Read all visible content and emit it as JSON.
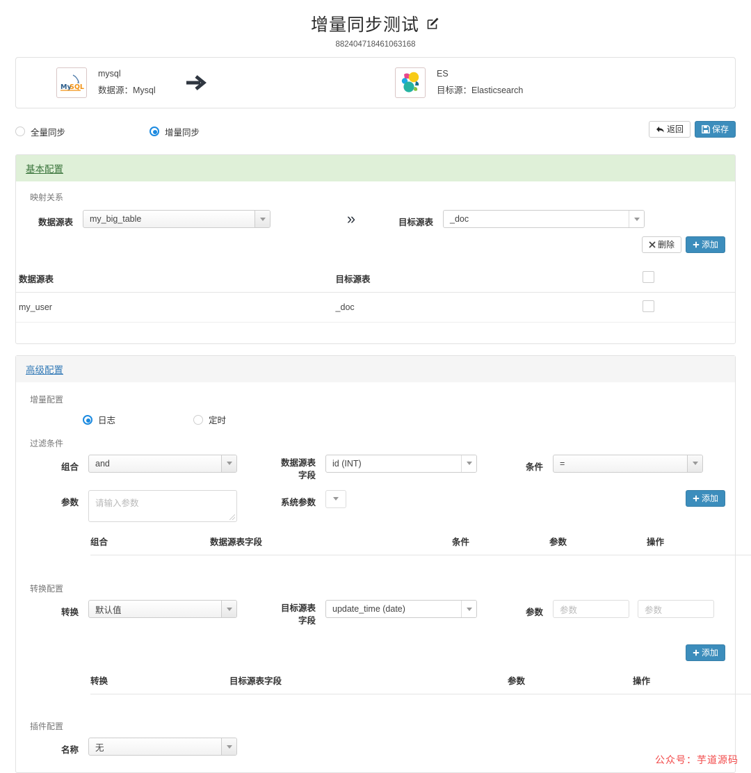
{
  "header": {
    "title": "增量同步测试",
    "edit_icon": "edit-pencil-icon",
    "job_id": "882404718461063168"
  },
  "datasource_panel": {
    "source": {
      "logo": "mysql-logo",
      "name": "mysql",
      "type_label": "数据源：Mysql"
    },
    "arrow_icon": "arrow-right-icon",
    "target": {
      "logo": "elasticsearch-logo",
      "name": "ES",
      "type_label": "目标源：Elasticsearch"
    }
  },
  "sync_mode": {
    "options": [
      {
        "label": "全量同步",
        "selected": false
      },
      {
        "label": "增量同步",
        "selected": true
      }
    ],
    "back_button": "返回",
    "save_button": "保存"
  },
  "basic_config": {
    "header": "基本配置",
    "mapping_label": "映射关系",
    "source_table_label": "数据源表",
    "source_table_value": "my_big_table",
    "chevron": "»",
    "target_table_label": "目标源表",
    "target_table_value": "_doc",
    "delete_button": "删除",
    "add_button": "添加",
    "table": {
      "columns": [
        "数据源表",
        "目标源表",
        ""
      ],
      "rows": [
        {
          "source": "my_user",
          "target": "_doc",
          "checked": false
        }
      ]
    }
  },
  "advanced_config": {
    "header": "高级配置",
    "incremental": {
      "label": "增量配置",
      "options": [
        {
          "label": "日志",
          "selected": true
        },
        {
          "label": "定时",
          "selected": false
        }
      ]
    },
    "filter": {
      "label": "过滤条件",
      "combine_label": "组合",
      "combine_value": "and",
      "field_label": "数据源表\n字段",
      "field_label_line1": "数据源表",
      "field_label_line2": "字段",
      "field_value": "id (INT)",
      "condition_label": "条件",
      "condition_value": "=",
      "param_label": "参数",
      "param_placeholder": "请输入参数",
      "param_value": "",
      "sys_param_label": "系统参数",
      "sys_param_value": "",
      "add_button": "添加",
      "table": {
        "columns": [
          "组合",
          "数据源表字段",
          "条件",
          "参数",
          "操作"
        ],
        "rows": []
      }
    },
    "transform": {
      "label": "转换配置",
      "transform_label": "转换",
      "transform_value": "默认值",
      "field_label_line1": "目标源表",
      "field_label_line2": "字段",
      "field_value": "update_time (date)",
      "param_label": "参数",
      "param1_placeholder": "参数",
      "param1_value": "",
      "param2_placeholder": "参数",
      "param2_value": "",
      "add_button": "添加",
      "table": {
        "columns": [
          "转换",
          "目标源表字段",
          "参数",
          "操作"
        ],
        "rows": []
      }
    },
    "plugin": {
      "label": "插件配置",
      "name_label": "名称",
      "name_value": "无"
    }
  },
  "watermark": "公众号：芋道源码",
  "colors": {
    "primary_blue": "#3c8dbc",
    "radio_blue": "#1b8ae0",
    "green_header_bg": "#dff0d8",
    "green_header_text": "#3c763d",
    "grey_header_bg": "#f5f5f5",
    "link_blue": "#337ab7",
    "watermark_red": "#f24a4a"
  }
}
